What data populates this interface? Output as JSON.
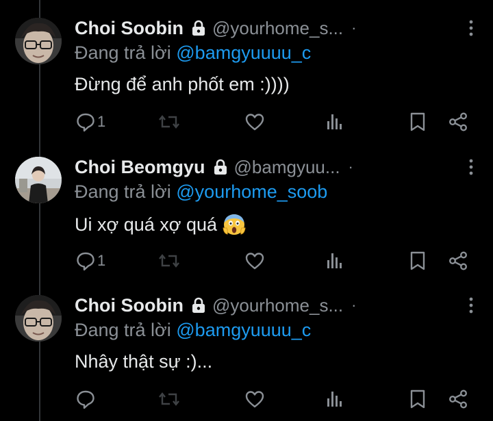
{
  "colors": {
    "background": "#000000",
    "text_primary": "#e7e9ea",
    "text_secondary": "#8b9096",
    "mention": "#1d9bf0",
    "thread_line": "#333639"
  },
  "tweets": [
    {
      "name": "Choi Soobin",
      "handle": "@yourhome_s...",
      "separator": "·",
      "reply_prefix": "Đang trả lời ",
      "mention": "@bamgyuuuu_c",
      "text": "Đừng để anh phốt em :))))",
      "emoji": "",
      "reply_count": "1",
      "avatar_icon": "soobin-avatar"
    },
    {
      "name": "Choi Beomgyu",
      "handle": "@bamgyuu...",
      "separator": "·",
      "reply_prefix": "Đang trả lời ",
      "mention": "@yourhome_soob",
      "text": "Ui xợ quá xợ quá",
      "emoji": "face-screaming-in-fear",
      "reply_count": "1",
      "avatar_icon": "beomgyu-avatar"
    },
    {
      "name": "Choi Soobin",
      "handle": "@yourhome_s...",
      "separator": "·",
      "reply_prefix": "Đang trả lời ",
      "mention": "@bamgyuuuu_c",
      "text": "Nhây thật sự :)...",
      "emoji": "",
      "reply_count": "",
      "avatar_icon": "soobin-avatar"
    }
  ],
  "action_icons": [
    "reply-icon",
    "retweet-icon",
    "like-icon",
    "views-icon",
    "bookmark-icon",
    "share-icon"
  ]
}
